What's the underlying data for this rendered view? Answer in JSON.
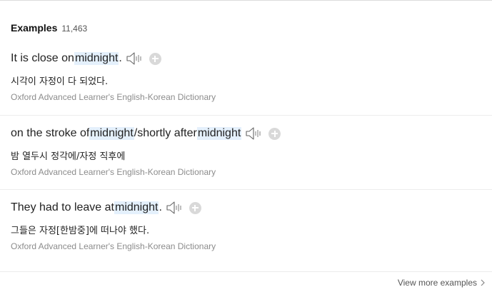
{
  "header": {
    "title": "Examples",
    "count": "11,463"
  },
  "examples": [
    {
      "parts": [
        {
          "text": "It is close on ",
          "hl": false
        },
        {
          "text": "midnight",
          "hl": true
        },
        {
          "text": ".",
          "hl": false
        }
      ],
      "translation": "시각이 자정이 다 되었다.",
      "source": "Oxford Advanced Learner's English-Korean Dictionary"
    },
    {
      "parts": [
        {
          "text": "on the stroke of ",
          "hl": false
        },
        {
          "text": "midnight",
          "hl": true
        },
        {
          "text": "/shortly after ",
          "hl": false
        },
        {
          "text": "midnight",
          "hl": true
        }
      ],
      "translation": "밤 열두시 정각에/자정 직후에",
      "source": "Oxford Advanced Learner's English-Korean Dictionary"
    },
    {
      "parts": [
        {
          "text": "They had to leave at ",
          "hl": false
        },
        {
          "text": "midnight",
          "hl": true
        },
        {
          "text": ".",
          "hl": false
        }
      ],
      "translation": "그들은 자정[한밤중]에 떠나야 했다.",
      "source": "Oxford Advanced Learner's English-Korean Dictionary"
    }
  ],
  "footer": {
    "more_label": "View more examples"
  },
  "icons": {
    "speaker": "speaker-icon",
    "add": "plus-circle-icon",
    "more": "chevron-right-icon"
  },
  "colors": {
    "highlight": "#e4f0fc",
    "source_text": "#8c8c8c",
    "add_button": "#d9d9d9"
  }
}
